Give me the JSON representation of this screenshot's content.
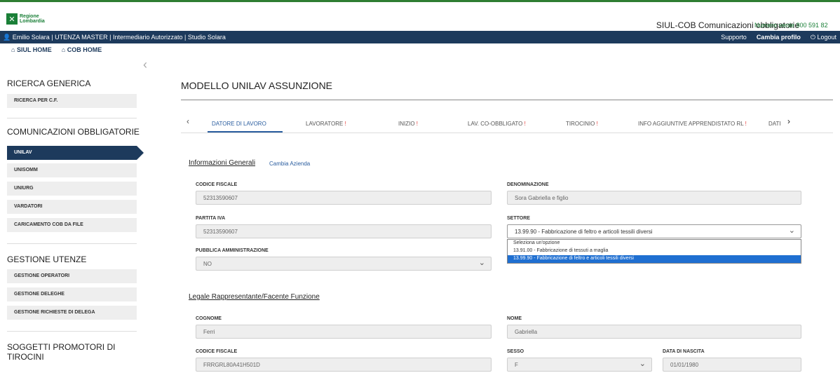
{
  "header": {
    "logo_line1": "Regione",
    "logo_line2": "Lombardia",
    "app_title": "SIUL-COB Comunicazioni obbligatorie",
    "numero_verde": "Numero verde 800 591 82"
  },
  "userbar": {
    "user_info": "Emilio Solara | UTENZA MASTER | Intermediario Autorizzato | Studio Solara",
    "supporto": "Supporto",
    "cambia_profilo": "Cambia profilo",
    "logout": "Logout"
  },
  "homes": {
    "siul_home": "SIUL HOME",
    "cob_home": "COB HOME"
  },
  "sidebar": {
    "ricerca_title": "RICERCA GENERICA",
    "ricerca_cf": "RICERCA PER C.F.",
    "comunicazioni_title": "COMUNICAZIONI OBBLIGATORIE",
    "unilav": "UNILAV",
    "unisomm": "UNISOMM",
    "uniurg": "UNIURG",
    "vardatori": "VARDATORI",
    "caricamento": "CARICAMENTO COB DA FILE",
    "gestione_title": "GESTIONE UTENZE",
    "gestione_operatori": "GESTIONE OPERATORI",
    "gestione_deleghe": "GESTIONE DELEGHE",
    "gestione_richieste": "GESTIONE RICHIESTE DI DELEGA",
    "soggetti_title_1": "SOGGETTI PROMOTORI DI",
    "soggetti_title_2": "TIROCINI"
  },
  "main": {
    "title": "MODELLO UNILAV ASSUNZIONE",
    "tabs": [
      {
        "label": "DATORE DI LAVORO",
        "bang": ""
      },
      {
        "label": "LAVORATORE",
        "bang": "!"
      },
      {
        "label": "INIZIO",
        "bang": "!"
      },
      {
        "label": "LAV. CO-OBBLIGATO",
        "bang": "!"
      },
      {
        "label": "TIROCINIO",
        "bang": "!"
      },
      {
        "label": "INFO AGGIUNTIVE APPRENDISTATO RL",
        "bang": "!"
      },
      {
        "label": "DATI",
        "bang": ""
      }
    ],
    "info_generali": "Informazioni Generali",
    "cambia_azienda": "Cambia Azienda",
    "codice_fiscale_label": "CODICE FISCALE",
    "codice_fiscale_value": "52313590607",
    "denominazione_label": "DENOMINAZIONE",
    "denominazione_value": "Sora Gabriella e figlio",
    "partita_iva_label": "PARTITA IVA",
    "partita_iva_value": "52313590607",
    "settore_label": "SETTORE",
    "settore_value": "13.99.90 - Fabbricazione di feltro e articoli tessili diversi",
    "settore_options": [
      "Seleziona un'opzione",
      "13.91.00 - Fabbricazione di tessuti a maglia",
      "13.99.90 - Fabbricazione di feltro e articoli tessili diversi"
    ],
    "pa_label": "PUBBLICA AMMINISTRAZIONE",
    "pa_value": "NO",
    "legale_title": "Legale Rappresentante/Facente Funzione",
    "cognome_label": "COGNOME",
    "cognome_value": "Ferri",
    "nome_label": "NOME",
    "nome_value": "Gabriella",
    "cf2_label": "CODICE FISCALE",
    "cf2_value": "FRRGRL80A41H501D",
    "sesso_label": "SESSO",
    "sesso_value": "F",
    "nascita_label": "DATA DI NASCITA",
    "nascita_value": "01/01/1980"
  }
}
